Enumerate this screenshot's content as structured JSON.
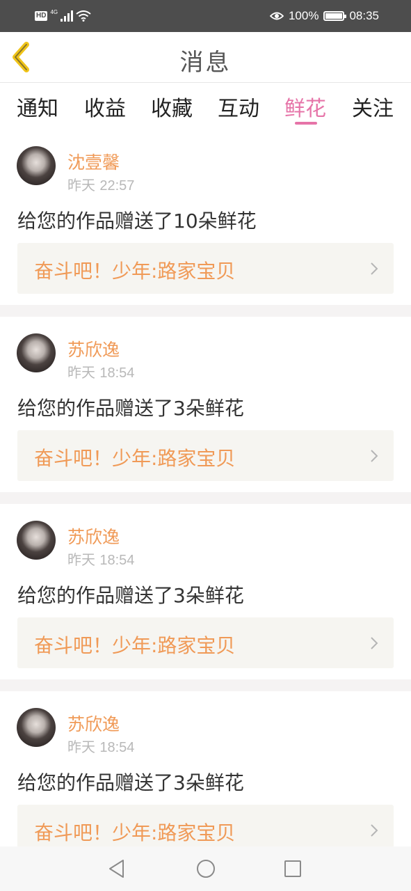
{
  "status_bar": {
    "hd": "HD",
    "network": "4G",
    "battery_percent": "100%",
    "battery_level": 1.0,
    "time": "08:35",
    "icons": [
      "signal-icon",
      "wifi-icon",
      "eye-icon",
      "battery-icon"
    ]
  },
  "header": {
    "title": "消息",
    "back_icon": "chevron-left-icon",
    "accent": "#f0c419"
  },
  "tabs": [
    {
      "label": "通知",
      "active": false
    },
    {
      "label": "收益",
      "active": false
    },
    {
      "label": "收藏",
      "active": false
    },
    {
      "label": "互动",
      "active": false
    },
    {
      "label": "鲜花",
      "active": true
    },
    {
      "label": "关注",
      "active": false
    }
  ],
  "colors": {
    "tab_active": "#e674a8",
    "name": "#f09a57",
    "time": "#b8b8b8",
    "link_bg": "#f6f5f1"
  },
  "messages": [
    {
      "user": "沈壹馨",
      "day": "昨天",
      "time": "22:57",
      "text": "给您的作品赠送了10朵鲜花",
      "work": "奋斗吧！少年:路家宝贝"
    },
    {
      "user": "苏欣逸",
      "day": "昨天",
      "time": "18:54",
      "text": "给您的作品赠送了3朵鲜花",
      "work": "奋斗吧！少年:路家宝贝"
    },
    {
      "user": "苏欣逸",
      "day": "昨天",
      "time": "18:54",
      "text": "给您的作品赠送了3朵鲜花",
      "work": "奋斗吧！少年:路家宝贝"
    },
    {
      "user": "苏欣逸",
      "day": "昨天",
      "time": "18:54",
      "text": "给您的作品赠送了3朵鲜花",
      "work": "奋斗吧！少年:路家宝贝"
    }
  ],
  "bottom_nav": {
    "icons": [
      "back-triangle-icon",
      "home-circle-icon",
      "recents-square-icon"
    ]
  }
}
